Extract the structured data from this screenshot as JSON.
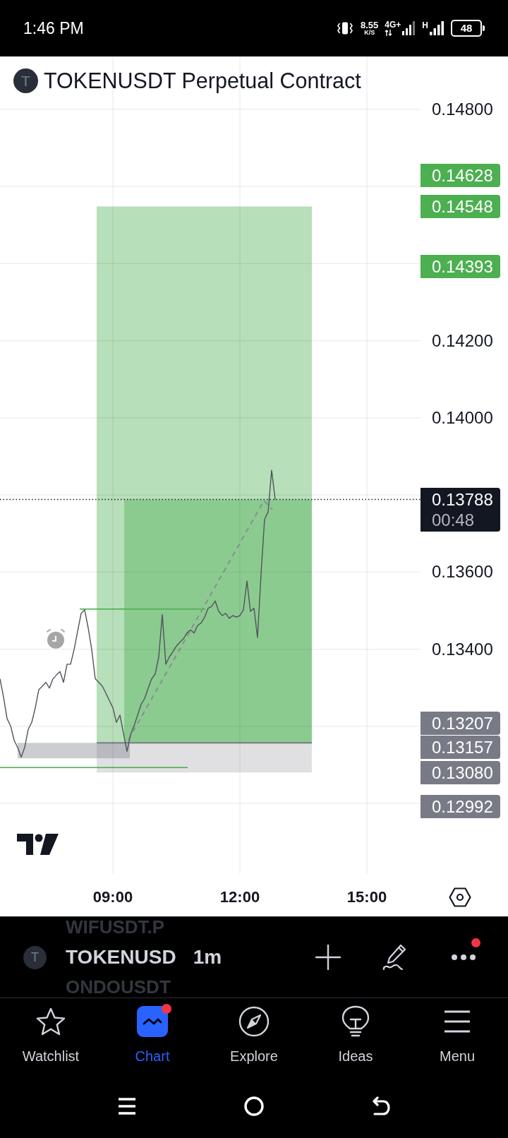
{
  "status_bar": {
    "time": "1:46 PM",
    "net_speed": "8.55",
    "net_speed_unit": "K/S",
    "network_type_1": "4G+",
    "network_type_2": "H",
    "battery": "48"
  },
  "chart": {
    "symbol_badge": "T",
    "title": "TOKENUSDT Perpetual Contract",
    "chart_data": {
      "type": "line",
      "x": [
        380,
        385,
        390,
        395,
        400,
        405,
        410,
        415,
        420,
        425,
        430,
        435,
        440,
        445,
        450,
        455,
        460,
        465,
        470,
        475,
        480,
        485,
        490,
        495,
        500,
        505,
        510,
        515,
        520,
        525,
        530,
        535,
        540,
        545,
        550,
        555,
        560,
        565,
        570,
        575,
        580,
        585,
        590,
        595,
        600,
        605,
        610,
        615,
        620,
        625,
        630,
        635,
        640,
        645,
        650,
        655,
        660,
        665,
        670,
        675,
        680,
        685,
        690,
        695,
        700,
        705,
        710,
        715,
        720,
        725,
        730,
        735,
        740,
        745,
        750,
        755,
        760,
        765,
        770
      ],
      "series": [
        {
          "color": "#50535e",
          "values": [
            0.13323,
            0.13276,
            0.1322,
            0.13201,
            0.13164,
            0.13145,
            0.1312,
            0.13145,
            0.13192,
            0.1321,
            0.13248,
            0.13295,
            0.13304,
            0.13314,
            0.13299,
            0.13323,
            0.13333,
            0.13342,
            0.13314,
            0.13361,
            0.13361,
            0.13399,
            0.13446,
            0.13493,
            0.13502,
            0.13455,
            0.13399,
            0.13323,
            0.13314,
            0.13304,
            0.13286,
            0.13267,
            0.13248,
            0.1321,
            0.13229,
            0.13182,
            0.13135,
            0.13178,
            0.13201,
            0.13229,
            0.13257,
            0.13272,
            0.13299,
            0.13323,
            0.13336,
            0.1338,
            0.1349,
            0.13361,
            0.1338,
            0.13393,
            0.13408,
            0.13418,
            0.13427,
            0.13442,
            0.1345,
            0.13442,
            0.13461,
            0.13468,
            0.13483,
            0.13506,
            0.13511,
            0.13525,
            0.13498,
            0.13487,
            0.13493,
            0.1348,
            0.13487,
            0.13483,
            0.13487,
            0.13502,
            0.13577,
            0.13498,
            0.13506,
            0.1343,
            0.13596,
            0.13737,
            0.13756,
            0.13864,
            0.13788
          ]
        }
      ],
      "xlim": [
        380,
        976
      ],
      "ylim": [
        0.12817,
        0.14937
      ],
      "xticks": [
        {
          "value": 540,
          "label": "09:00"
        },
        {
          "value": 720,
          "label": "12:00"
        },
        {
          "value": 900,
          "label": "15:00"
        }
      ],
      "yticks": [
        {
          "value": 0.148,
          "label": "0.14800"
        },
        {
          "value": 0.142,
          "label": "0.14200"
        },
        {
          "value": 0.14,
          "label": "0.14000"
        },
        {
          "value": 0.136,
          "label": "0.13600"
        },
        {
          "value": 0.134,
          "label": "0.13400"
        }
      ],
      "grid": true
    },
    "price_labels": [
      {
        "text": "0.14628",
        "color": "#4caf50"
      },
      {
        "text": "0.14548",
        "color": "#4caf50"
      },
      {
        "text": "0.14393",
        "color": "#4caf50"
      },
      {
        "text": "0.13207",
        "color": "#787b86"
      },
      {
        "text": "0.13157",
        "color": "#787b86"
      },
      {
        "text": "0.13080",
        "color": "#787b86"
      },
      {
        "text": "0.12992",
        "color": "#787b86"
      }
    ],
    "current_price": {
      "price": "0.13788",
      "countdown": "00:48"
    }
  },
  "toolbar": {
    "prev_symbol": "WIFUSDT.P",
    "symbol_badge": "T",
    "symbol": "TOKENUSD",
    "interval": "1m",
    "next_symbol": "ONDOUSDT",
    "more_badge": true
  },
  "tabs": [
    {
      "label": "Watchlist",
      "kind": "watchlist",
      "selected": false,
      "badge": false
    },
    {
      "label": "Chart",
      "kind": "chart",
      "selected": true,
      "badge": true
    },
    {
      "label": "Explore",
      "kind": "explore",
      "selected": false,
      "badge": false
    },
    {
      "label": "Ideas",
      "kind": "ideas",
      "selected": false,
      "badge": false
    },
    {
      "label": "Menu",
      "kind": "menu",
      "selected": false,
      "badge": false
    }
  ]
}
